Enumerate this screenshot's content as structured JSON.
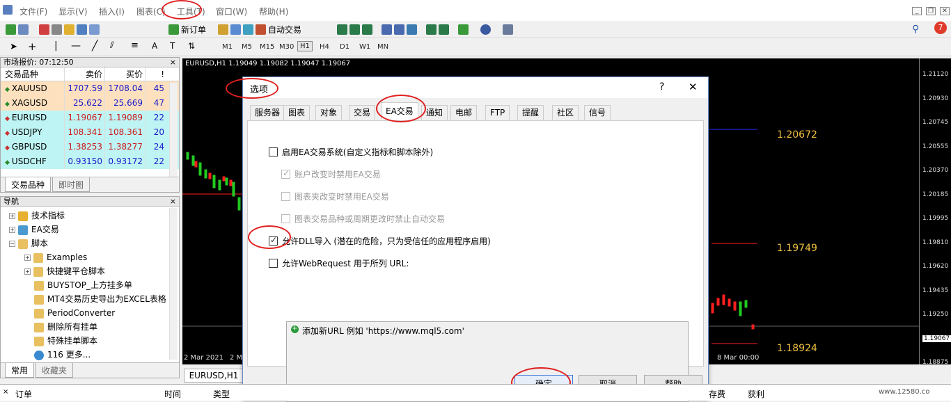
{
  "menu": [
    "文件(F)",
    "显示(V)",
    "插入(I)",
    "图表(C)",
    "工具(T)",
    "窗口(W)",
    "帮助(H)"
  ],
  "toolbar": {
    "new_order": "新订单",
    "auto_trading": "自动交易",
    "notif_count": "7"
  },
  "timeframes": [
    "M1",
    "M5",
    "M15",
    "M30",
    "H1",
    "H4",
    "D1",
    "W1",
    "MN"
  ],
  "timeframe_selected": "H1",
  "market_watch": {
    "title": "市场报价: 07:12:50",
    "headers": [
      "交易品种",
      "卖价",
      "买价",
      "!"
    ],
    "rows": [
      {
        "symbol": "XAUUSD",
        "bid": "1707.59",
        "ask": "1708.04",
        "spread": "45",
        "dir": "up",
        "bg": "#fde1bf"
      },
      {
        "symbol": "XAGUSD",
        "bid": "25.622",
        "ask": "25.669",
        "spread": "47",
        "dir": "up",
        "bg": "#fde1bf"
      },
      {
        "symbol": "EURUSD",
        "bid": "1.19067",
        "ask": "1.19089",
        "spread": "22",
        "dir": "down",
        "bg": "#bff4f4"
      },
      {
        "symbol": "USDJPY",
        "bid": "108.341",
        "ask": "108.361",
        "spread": "20",
        "dir": "down",
        "bg": "#bff4f4"
      },
      {
        "symbol": "GBPUSD",
        "bid": "1.38253",
        "ask": "1.38277",
        "spread": "24",
        "dir": "down",
        "bg": "#bff4f4"
      },
      {
        "symbol": "USDCHF",
        "bid": "0.93150",
        "ask": "0.93172",
        "spread": "22",
        "dir": "up",
        "bg": "#bff4f4"
      }
    ],
    "tabs": [
      "交易品种",
      "即时图"
    ]
  },
  "navigator": {
    "title": "导航",
    "items": [
      "技术指标",
      "EA交易",
      "脚本",
      "Examples",
      "快捷键平仓脚本",
      "BUYSTOP_上方挂多单",
      "MT4交易历史导出为EXCEL表格",
      "PeriodConverter",
      "删除所有挂单",
      "特殊挂单脚本",
      "116 更多..."
    ],
    "tabs": [
      "常用",
      "收藏夹"
    ]
  },
  "chart": {
    "header": "EURUSD,H1  1.19049 1.19082 1.19047 1.19067",
    "tab": "EURUSD,H1",
    "price_levels": [
      "1.21120",
      "1.20930",
      "1.20745",
      "1.20555",
      "1.20370",
      "1.20185",
      "1.19995",
      "1.19810",
      "1.19620",
      "1.19435",
      "1.19250",
      "1.19067",
      "1.18875"
    ],
    "labels": [
      "1.20672",
      "1.19749",
      "1.18924"
    ],
    "dates": [
      "2 Mar 2021",
      "2 Ma",
      "8 Mar 00:00"
    ]
  },
  "dialog": {
    "title": "选项",
    "help": "?",
    "close": "✕",
    "tabs": [
      "服务器",
      "图表",
      "对象",
      "交易",
      "EA交易",
      "通知",
      "电邮",
      "FTP",
      "提醒",
      "社区",
      "信号"
    ],
    "active_tab": "EA交易",
    "options": [
      {
        "label": "启用EA交易系统(自定义指标和脚本除外)",
        "checked": false,
        "disabled": false
      },
      {
        "label": "账户改变时禁用EA交易",
        "checked": true,
        "disabled": true
      },
      {
        "label": "图表夹改变时禁用EA交易",
        "checked": false,
        "disabled": true
      },
      {
        "label": "图表交易品种或周期更改时禁止自动交易",
        "checked": false,
        "disabled": true
      },
      {
        "label": "允许DLL导入 (潜在的危险，只为受信任的应用程序启用)",
        "checked": true,
        "disabled": false
      },
      {
        "label": "允许WebRequest 用于所列 URL:",
        "checked": false,
        "disabled": false
      }
    ],
    "url_hint": "添加新URL 例如 'https://www.mql5.com'",
    "buttons": {
      "ok": "确定",
      "cancel": "取消",
      "help": "帮助"
    }
  },
  "bottom": {
    "order": "订单",
    "time": "时间",
    "type": "类型",
    "fee": "存费",
    "profit": "获利",
    "watermark": "www.12580.co"
  }
}
